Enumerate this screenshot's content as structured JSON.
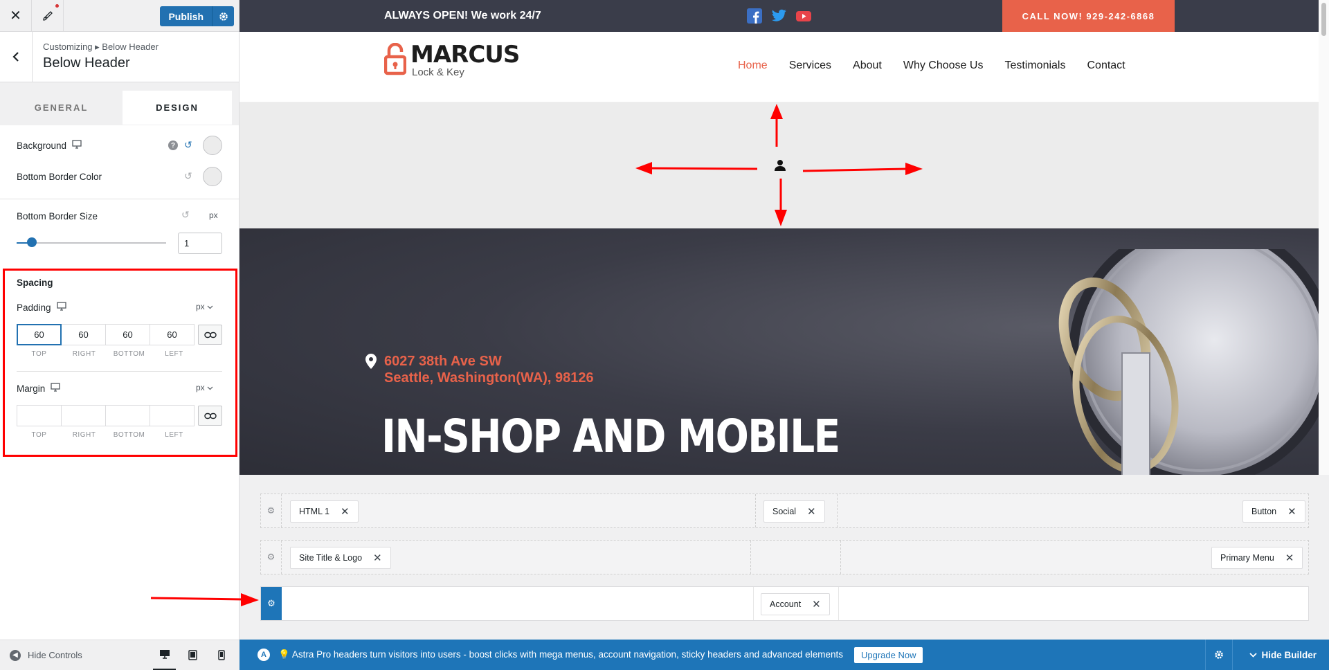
{
  "sidebar": {
    "publish_label": "Publish",
    "breadcrumb": "Customizing ▸ Below Header",
    "title": "Below Header",
    "tabs": [
      {
        "label": "GENERAL"
      },
      {
        "label": "DESIGN"
      }
    ],
    "background_label": "Background",
    "bottom_border_color_label": "Bottom Border Color",
    "bottom_border_size_label": "Bottom Border Size",
    "bottom_border_size_unit": "px",
    "bottom_border_size_value": "1",
    "spacing_title": "Spacing",
    "padding": {
      "label": "Padding",
      "unit": "px",
      "values": [
        "60",
        "60",
        "60",
        "60"
      ],
      "sides": [
        "TOP",
        "RIGHT",
        "BOTTOM",
        "LEFT"
      ]
    },
    "margin": {
      "label": "Margin",
      "unit": "px",
      "sides": [
        "TOP",
        "RIGHT",
        "BOTTOM",
        "LEFT"
      ]
    },
    "hide_controls": "Hide Controls"
  },
  "site": {
    "topbar_text": "ALWAYS OPEN! We work 24/7",
    "call_label": "CALL NOW! 929-242-6868",
    "logo_main": "MARCUS",
    "logo_sub": "Lock & Key",
    "nav": [
      "Home",
      "Services",
      "About",
      "Why Choose Us",
      "Testimonials",
      "Contact"
    ],
    "address_line1": "6027 38th Ave SW",
    "address_line2": "Seattle, Washington(WA), 98126",
    "hero_title": "IN-SHOP AND MOBILE",
    "accent": "#e8624a"
  },
  "builder": {
    "row1": [
      "HTML 1",
      "Social",
      "Button"
    ],
    "row2": [
      "Site Title & Logo",
      "Primary Menu"
    ],
    "row3": [
      "Account"
    ]
  },
  "pro_bar": {
    "text": "💡 Astra Pro headers turn visitors into users - boost clicks with mega menus, account navigation, sticky headers and advanced elements",
    "upgrade_label": "Upgrade Now",
    "hide_builder_label": "Hide Builder"
  }
}
